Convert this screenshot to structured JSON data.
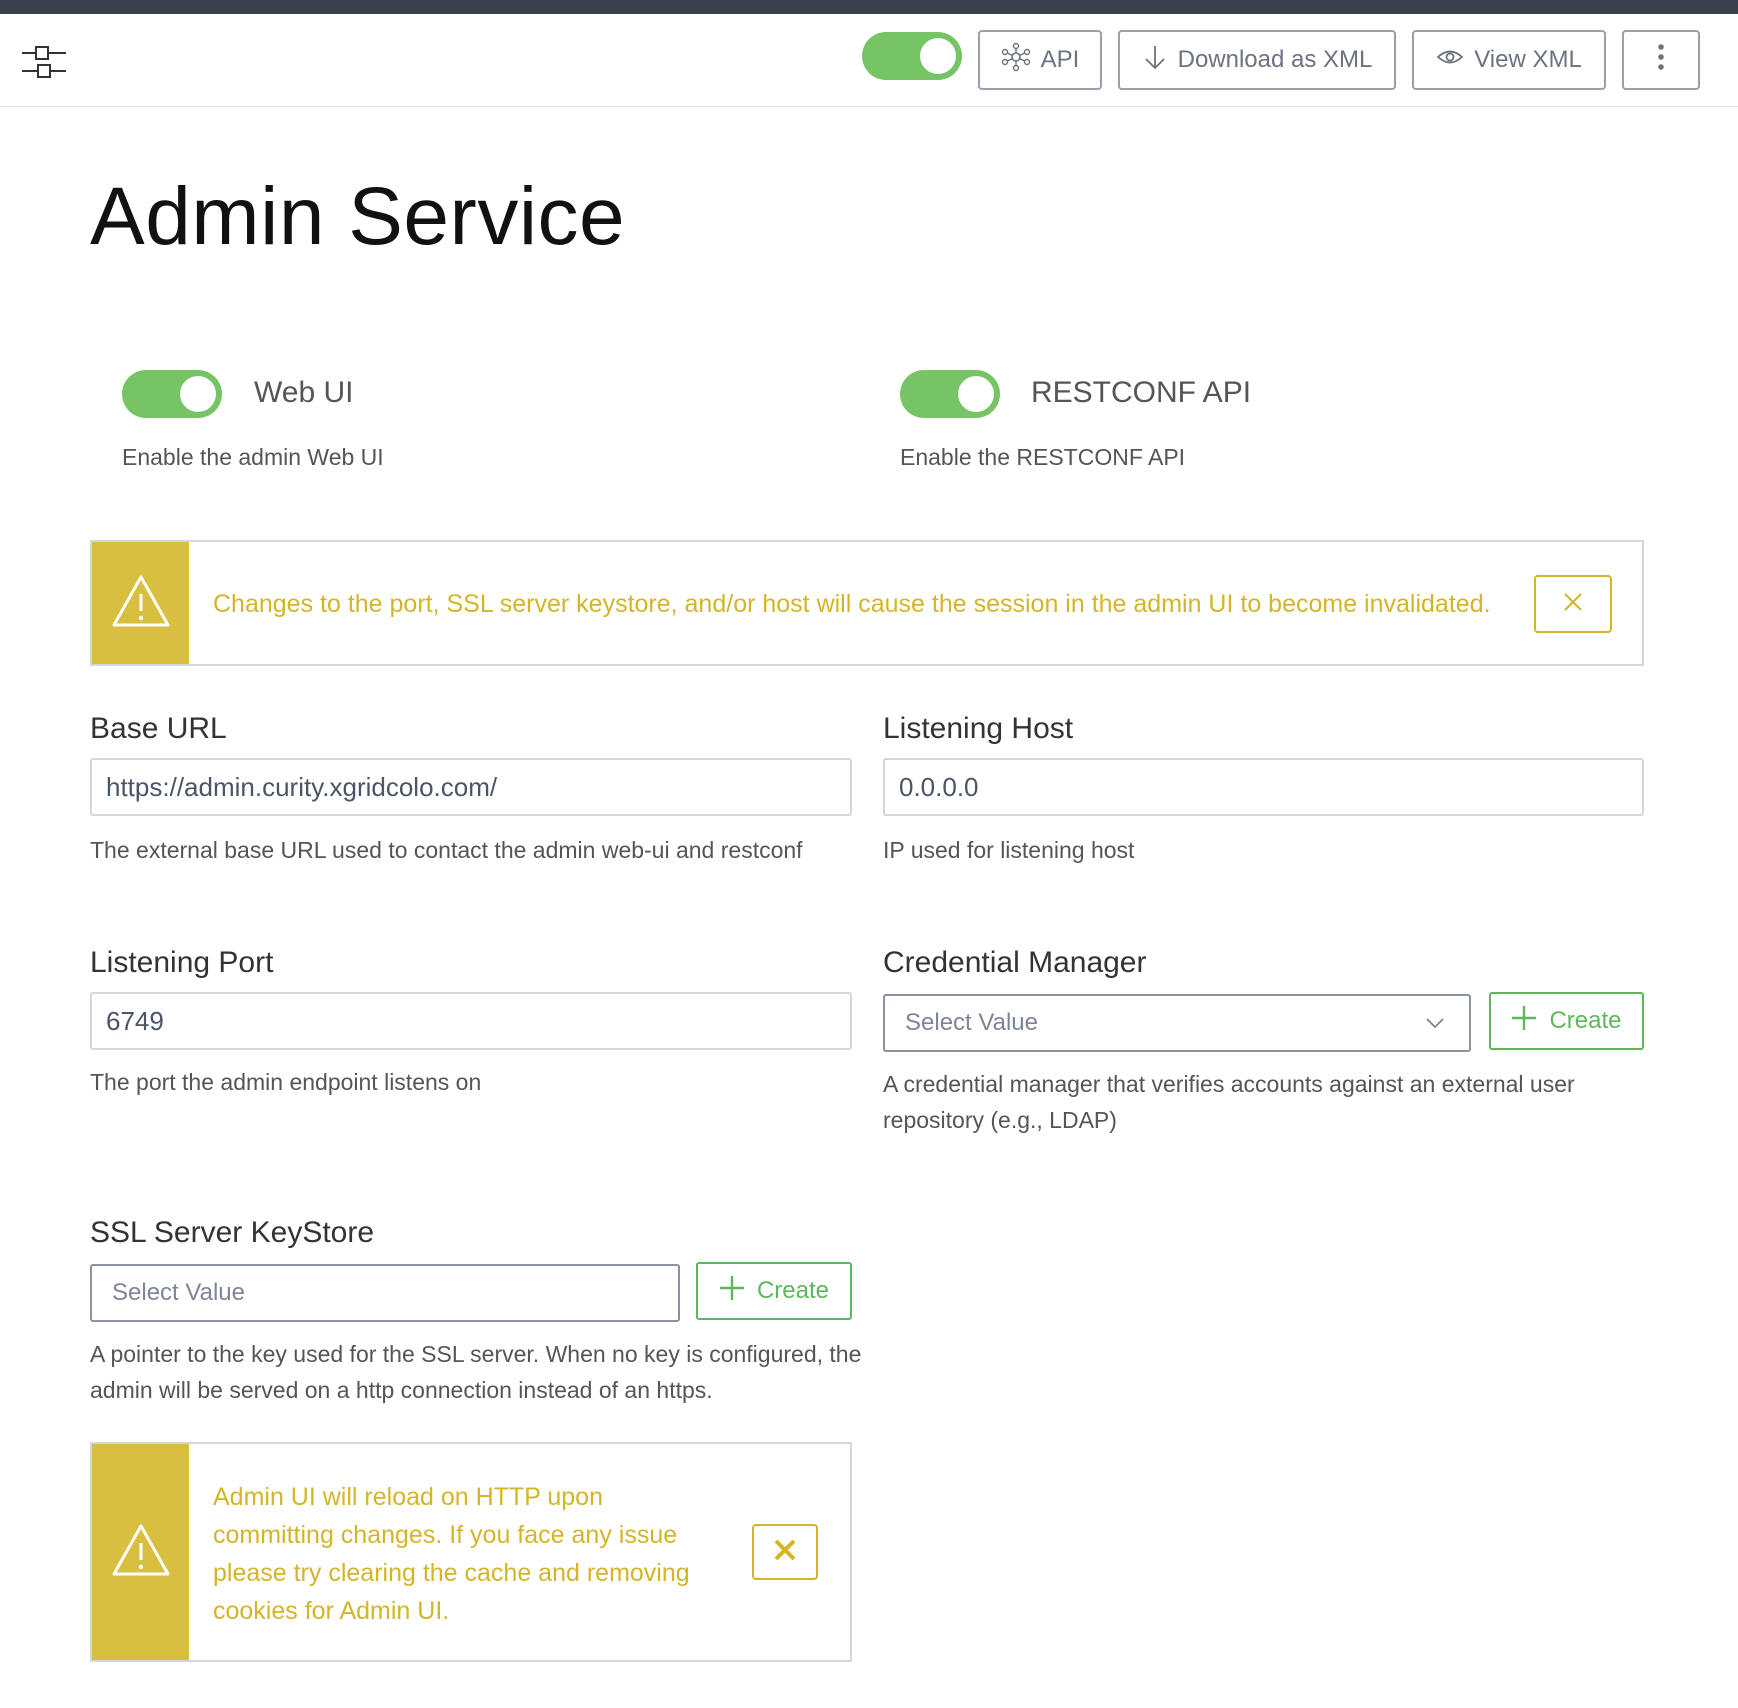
{
  "toolbar": {
    "api_label": "API",
    "download_label": "Download as XML",
    "view_label": "View XML"
  },
  "page": {
    "title": "Admin Service"
  },
  "switches": {
    "web_ui": {
      "label": "Web UI",
      "description": "Enable the admin Web UI",
      "enabled": true
    },
    "restconf": {
      "label": "RESTCONF API",
      "description": "Enable the RESTCONF API",
      "enabled": true
    }
  },
  "warning_top": {
    "message": "Changes to the port, SSL server keystore, and/or host will cause the session in the admin UI to become invalidated."
  },
  "fields": {
    "base_url": {
      "label": "Base URL",
      "value": "https://admin.curity.xgridcolo.com/",
      "hint": "The external base URL used to contact the admin web-ui and restconf"
    },
    "listening_host": {
      "label": "Listening Host",
      "value": "0.0.0.0",
      "hint": "IP used for listening host"
    },
    "listening_port": {
      "label": "Listening Port",
      "value": "6749",
      "hint": "The port the admin endpoint listens on"
    },
    "credential_manager": {
      "label": "Credential Manager",
      "placeholder": "Select Value",
      "create_label": "Create",
      "hint": "A credential manager that verifies accounts against an external user repository (e.g., LDAP)"
    },
    "ssl_keystore": {
      "label": "SSL Server KeyStore",
      "placeholder": "Select Value",
      "create_label": "Create",
      "hint": "A pointer to the key used for the SSL server. When no key is configured, the admin will be served on a http connection instead of an https."
    }
  },
  "warning_bottom": {
    "message": "Admin UI will reload on HTTP upon committing changes. If you face any issue please try clearing the cache and removing cookies for Admin UI."
  },
  "colors": {
    "toggle_on": "#76c466",
    "warning_bar": "#d8bf3f",
    "warning_text": "#d4b529",
    "create_green": "#5db85c",
    "top_strip": "#3a404e"
  }
}
